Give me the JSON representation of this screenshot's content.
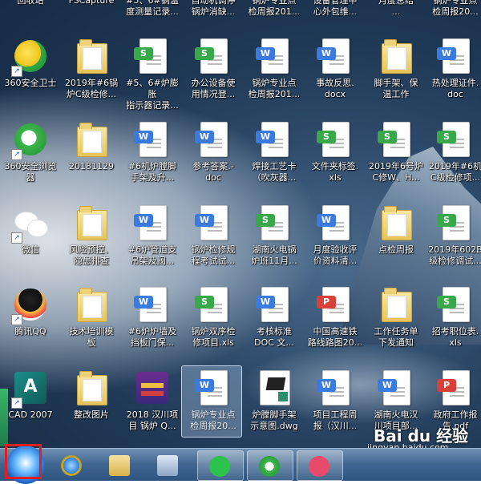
{
  "desktop": {
    "top_row": [
      {
        "label": "回收站",
        "type": "recycle"
      },
      {
        "label": "FSCapture",
        "type": "app"
      },
      {
        "label": "#5、6#锅温\n度测量记录...",
        "type": "word"
      },
      {
        "label": "自动机调停\n锅炉消缺...",
        "type": "word"
      },
      {
        "label": "锅炉专业点\n检周报201...",
        "type": "word"
      },
      {
        "label": "设备管理中\n心外包维...",
        "type": "word"
      },
      {
        "label": "月度总结\n...",
        "type": "word"
      },
      {
        "label": "锅炉专业点\n检周报20...",
        "type": "word"
      }
    ],
    "icons": [
      [
        {
          "label": "360安全卫士",
          "type": "safe",
          "shortcut": true
        },
        {
          "label": "2019年#6锅\n炉C级检修...",
          "type": "folder"
        },
        {
          "label": "#5、6#炉膨胀\n指示器记录...",
          "type": "excel"
        },
        {
          "label": "办公设备使\n用情况登...",
          "type": "excel"
        },
        {
          "label": "锅炉专业点\n检周报201...",
          "type": "word"
        },
        {
          "label": "事故反思.\ndocx",
          "type": "word"
        },
        {
          "label": "脚手架、保\n温工作",
          "type": "folder"
        },
        {
          "label": "热处理证件.\ndoc",
          "type": "word"
        }
      ],
      [
        {
          "label": "360安全浏览\n器",
          "type": "browser",
          "shortcut": true
        },
        {
          "label": "20181129",
          "type": "folder"
        },
        {
          "label": "#6机炉膛脚\n手架及升...",
          "type": "word"
        },
        {
          "label": "参考答案.-\ndoc",
          "type": "word"
        },
        {
          "label": "焊接工艺卡\n（吹灰器...",
          "type": "word"
        },
        {
          "label": "文件夹标签.\nxls",
          "type": "excel"
        },
        {
          "label": "2019年6号炉\nC修W、H...",
          "type": "excel"
        },
        {
          "label": "2019年#6机\nC级检修项...",
          "type": "excel"
        }
      ],
      [
        {
          "label": "微信",
          "type": "wechat",
          "shortcut": true
        },
        {
          "label": "风险预控、\n隐患排查",
          "type": "folder"
        },
        {
          "label": "#6炉管道支\n吊架及阀...",
          "type": "word"
        },
        {
          "label": "锅炉检修规\n程考试试...",
          "type": "word"
        },
        {
          "label": "湖南火电锅\n炉班11月...",
          "type": "excel"
        },
        {
          "label": "月度验收评\n价资料清...",
          "type": "word"
        },
        {
          "label": "点检周报",
          "type": "folder"
        },
        {
          "label": "2019年602B\n级检修调试...",
          "type": "excel"
        }
      ],
      [
        {
          "label": "腾讯QQ",
          "type": "qq",
          "shortcut": true
        },
        {
          "label": "技术培训模\n板",
          "type": "folder"
        },
        {
          "label": "#6炉炉墙及\n挡板门保...",
          "type": "word"
        },
        {
          "label": "锅炉双序检\n修项目.xls",
          "type": "excel"
        },
        {
          "label": "考核标准\nDOC 文...",
          "type": "word"
        },
        {
          "label": "中国高速铁\n路线路图20...",
          "type": "pdf"
        },
        {
          "label": "工作任务单\n下发通知",
          "type": "folder"
        },
        {
          "label": "招考职位表.\nxls",
          "type": "excel"
        }
      ],
      [
        {
          "label": "CAD 2007",
          "type": "cad",
          "shortcut": true
        },
        {
          "label": "整改图片",
          "type": "folder"
        },
        {
          "label": "2018 汉川项\n目 锅炉 Q...",
          "type": "winrar"
        },
        {
          "label": "锅炉专业点\n检周报20...",
          "type": "word",
          "selected": true
        },
        {
          "label": "炉膛脚手架\n示意图.dwg",
          "type": "dwg"
        },
        {
          "label": "项目工程周\n报（汉川...",
          "type": "word"
        },
        {
          "label": "湖南火电汉\n川项目部...",
          "type": "word"
        },
        {
          "label": "政府工作报\n告.pdf",
          "type": "pdf"
        }
      ]
    ]
  },
  "taskbar": {
    "items": [
      {
        "name": "start-button-icon"
      },
      {
        "name": "ie-icon"
      },
      {
        "name": "explorer-icon"
      },
      {
        "name": "calculator-icon"
      },
      {
        "name": "wechat-taskbar-icon"
      },
      {
        "name": "360-browser-taskbar-icon"
      },
      {
        "name": "heart-app-icon"
      }
    ]
  },
  "watermark": {
    "logo": "Bai du 经验",
    "url": "jingyan.baidu.com"
  },
  "colors": {
    "highlight": "#e02020",
    "taskbar": "#3f6590"
  }
}
